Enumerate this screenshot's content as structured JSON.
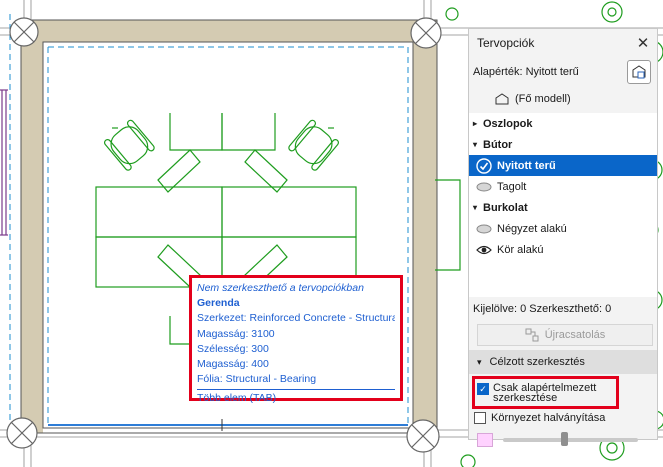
{
  "tooltip": {
    "not_editable": "Nem szerkeszthető a tervopciókban",
    "element": "Gerenda",
    "structure": "Szerkezet: Reinforced Concrete - Structural",
    "height1": "Magasság: 3100",
    "width": "Szélesség: 300",
    "height2": "Magasság: 400",
    "layer": "Fólia: Structural - Bearing",
    "more": "Több elem (TAB)"
  },
  "panel": {
    "title": "Tervopciók",
    "base_label": "Alapérték: Nyitott terű",
    "main_model": "(Fő modell)",
    "groups": [
      {
        "label": "Oszlopok"
      },
      {
        "label": "Bútor",
        "items": [
          {
            "label": "Nyitott terű",
            "selected": true,
            "icon": "check-circle-icon"
          },
          {
            "label": "Tagolt",
            "icon": "eye-closed-icon"
          }
        ]
      },
      {
        "label": "Burkolat",
        "items": [
          {
            "label": "Négyzet alakú",
            "icon": "eye-closed-icon"
          },
          {
            "label": "Kör alakú",
            "icon": "eye-open-icon"
          }
        ]
      }
    ],
    "status": "Kijelölve: 0 Szerkeszthető: 0",
    "relink": "Újracsatolás",
    "targeted_edit": "Célzott szerkesztés",
    "base_only_edit": "Csak alapértelmezett szerkesztése",
    "base_only_checked": true,
    "fade_env": "Környezet halványítása",
    "fade_env_checked": false,
    "fade_level": 0.45
  },
  "colors": {
    "drawing": "#1f9d1f",
    "wall_fill": "#d4cbb2",
    "accent": "#0a66c9",
    "highlight": "#e3001b",
    "tooltip_text": "#1e5fd1"
  }
}
